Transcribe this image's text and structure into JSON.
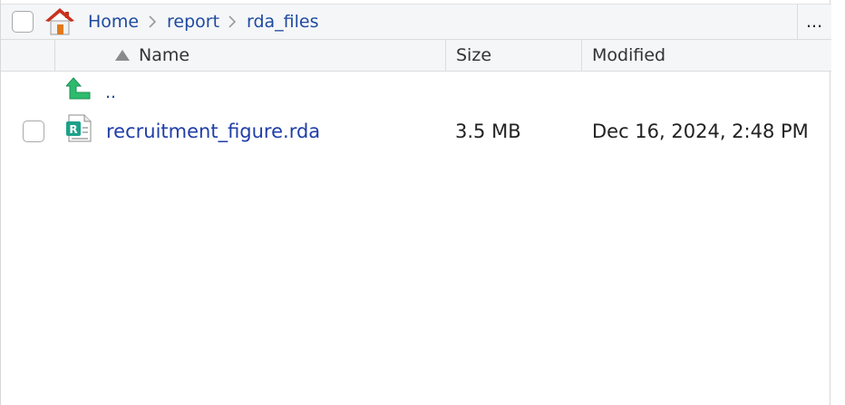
{
  "breadcrumb": {
    "items": [
      "Home",
      "report",
      "rda_files"
    ]
  },
  "toolbar": {
    "more_label": "..."
  },
  "columns": {
    "name": "Name",
    "size": "Size",
    "modified": "Modified"
  },
  "parent_dir": {
    "label": ".."
  },
  "files": [
    {
      "name": "recruitment_figure.rda",
      "size": "3.5 MB",
      "modified": "Dec 16, 2024, 2:48 PM"
    }
  ],
  "icons": {
    "home": "home-icon",
    "up": "arrow-up-icon",
    "rda": "r-data-file-icon",
    "sort": "sort-ascending-icon",
    "separator": "chevron-right-icon"
  },
  "colors": {
    "link": "#1f4aa0",
    "header_bg": "#f4f6f8",
    "up_arrow": "#2dbb6e"
  }
}
